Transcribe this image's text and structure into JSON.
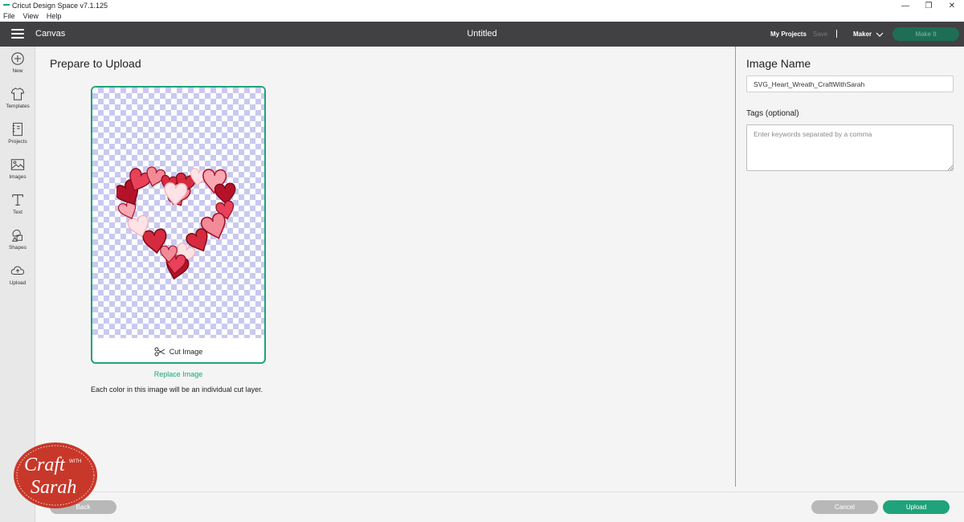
{
  "window": {
    "title": "Cricut Design Space  v7.1.125",
    "minimize_glyph": "—",
    "restore_glyph": "❐",
    "close_glyph": "✕"
  },
  "menu": [
    "File",
    "View",
    "Help"
  ],
  "header": {
    "canvas_label": "Canvas",
    "doc_title": "Untitled",
    "my_projects": "My Projects",
    "save": "Save",
    "machine": "Maker",
    "make_it": "Make It"
  },
  "sidebar": {
    "items": [
      {
        "label": "New",
        "icon": "plus-circle-icon"
      },
      {
        "label": "Templates",
        "icon": "tshirt-icon"
      },
      {
        "label": "Projects",
        "icon": "notebook-icon"
      },
      {
        "label": "Images",
        "icon": "image-icon"
      },
      {
        "label": "Text",
        "icon": "text-icon"
      },
      {
        "label": "Shapes",
        "icon": "shapes-icon"
      },
      {
        "label": "Upload",
        "icon": "cloud-upload-icon"
      }
    ]
  },
  "main": {
    "title": "Prepare to Upload",
    "cut_image": "Cut Image",
    "replace_image": "Replace Image",
    "info": "Each color in this image will be an individual cut layer."
  },
  "details": {
    "image_name_label": "Image Name",
    "image_name_value": "SVG_Heart_Wreath_CraftWithSarah",
    "tags_label": "Tags (optional)",
    "tags_placeholder": "Enter keywords separated by a comma"
  },
  "footer": {
    "back": "Back",
    "cancel": "Cancel",
    "upload": "Upload"
  },
  "watermark": {
    "line1": "Craft",
    "line2": "WITH",
    "line3": "Sarah"
  },
  "colors": {
    "accent": "#1fa37a",
    "header_bg": "#414042",
    "make_it_disabled": "#1d6e55",
    "badge_red": "#c8382a"
  }
}
